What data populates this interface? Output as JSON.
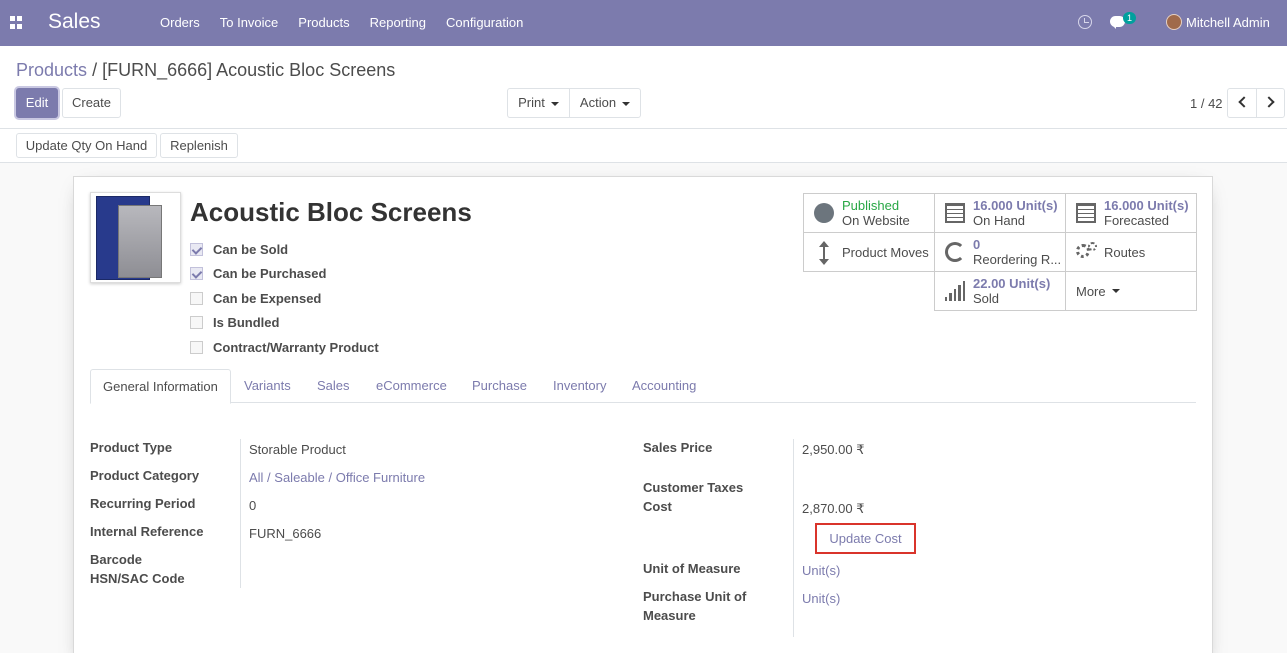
{
  "navbar": {
    "app_title": "Sales",
    "menu": [
      "Orders",
      "To Invoice",
      "Products",
      "Reporting",
      "Configuration"
    ],
    "chat_badge": "1",
    "user_name": "Mitchell Admin",
    "color": "#7c7bad"
  },
  "breadcrumb": {
    "parent": "Products",
    "separator": "/",
    "current": "[FURN_6666] Acoustic Bloc Screens"
  },
  "toolbar": {
    "edit": "Edit",
    "create": "Create",
    "print": "Print",
    "action": "Action",
    "pager": "1 / 42"
  },
  "status_actions": {
    "update_qty": "Update Qty On Hand",
    "replenish": "Replenish"
  },
  "product": {
    "name": "Acoustic Bloc Screens",
    "checkboxes": [
      {
        "label": "Can be Sold",
        "checked": true
      },
      {
        "label": "Can be Purchased",
        "checked": true
      },
      {
        "label": "Can be Expensed",
        "checked": false
      },
      {
        "label": "Is Bundled",
        "checked": false
      },
      {
        "label": "Contract/Warranty Product",
        "checked": false
      }
    ]
  },
  "smart_buttons": {
    "published": {
      "value": "Published",
      "label": "On Website",
      "icon": "globe-icon",
      "color": "#28a745"
    },
    "on_hand": {
      "value": "16.000 Unit(s)",
      "label": "On Hand",
      "icon": "building-icon"
    },
    "forecasted": {
      "value": "16.000 Unit(s)",
      "label": "Forecasted",
      "icon": "building-icon"
    },
    "product_moves": {
      "label": "Product Moves",
      "icon": "exchange-vertical-icon"
    },
    "reordering": {
      "value": "0",
      "label": "Reordering R...",
      "icon": "refresh-icon"
    },
    "routes": {
      "label": "Routes",
      "icon": "cogs-icon"
    },
    "sold": {
      "value": "22.00 Unit(s)",
      "label": "Sold",
      "icon": "signal-icon"
    },
    "more": {
      "label": "More"
    }
  },
  "tabs": [
    "General Information",
    "Variants",
    "Sales",
    "eCommerce",
    "Purchase",
    "Inventory",
    "Accounting"
  ],
  "fields_left": {
    "product_type": {
      "label": "Product Type",
      "value": "Storable Product"
    },
    "product_category": {
      "label": "Product Category",
      "value": "All / Saleable / Office Furniture"
    },
    "recurring_period": {
      "label": "Recurring Period",
      "value": "0"
    },
    "internal_reference": {
      "label": "Internal Reference",
      "value": "FURN_6666"
    },
    "barcode": {
      "label": "Barcode",
      "value": ""
    },
    "hsn_code": {
      "label": "HSN/SAC Code",
      "value": ""
    }
  },
  "fields_right": {
    "sales_price": {
      "label": "Sales Price",
      "value": "2,950.00 ₹"
    },
    "customer_taxes": {
      "label": "Customer Taxes",
      "value": ""
    },
    "cost": {
      "label": "Cost",
      "value": "2,870.00 ₹"
    },
    "update_cost": "Update Cost",
    "uom": {
      "label": "Unit of Measure",
      "value": "Unit(s)"
    },
    "purchase_uom_line1": "Purchase Unit of",
    "purchase_uom_line2": "Measure",
    "purchase_uom_value": "Unit(s)"
  }
}
